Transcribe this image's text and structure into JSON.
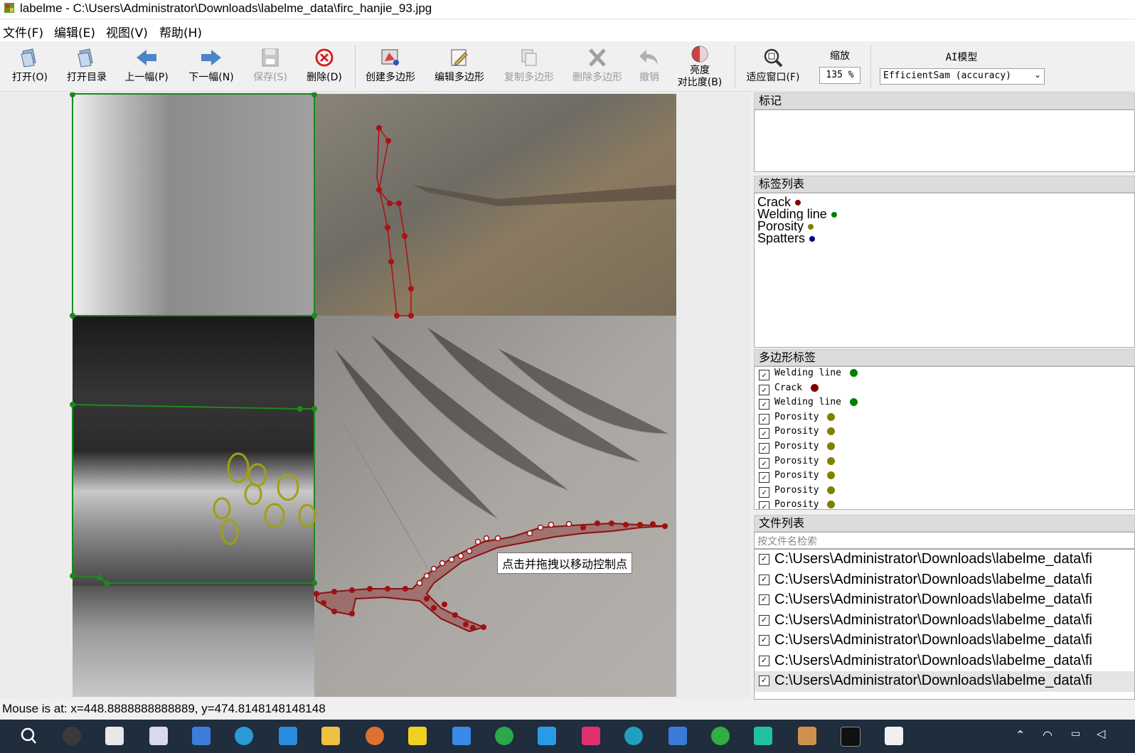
{
  "window": {
    "title": "labelme - C:\\Users\\Administrator\\Downloads\\labelme_data\\firc_hanjie_93.jpg"
  },
  "menu": [
    "文件(F)",
    "编辑(E)",
    "视图(V)",
    "帮助(H)"
  ],
  "toolbar": {
    "open": "打开(O)",
    "open_dir": "打开目录",
    "prev": "上一幅(P)",
    "next": "下一幅(N)",
    "save": "保存(S)",
    "delete": "删除(D)",
    "create_poly": "创建多边形",
    "edit_poly": "编辑多边形",
    "copy_poly": "复制多边形",
    "delete_poly": "删除多边形",
    "undo": "撤销",
    "brightness_line1": "亮度",
    "brightness_line2": "对比度(B)",
    "fit_window": "适应窗口(F)",
    "zoom_label": "缩放",
    "zoom_value": "135 %",
    "ai_label": "AI模型",
    "ai_model": "EfficientSam (accuracy)"
  },
  "canvas": {
    "tooltip": "点击并拖拽以移动控制点"
  },
  "docks": {
    "flags_title": "标记",
    "labels_title": "标签列表",
    "labels": [
      {
        "name": "Crack",
        "color": "#8b0000"
      },
      {
        "name": "Welding line",
        "color": "#008000"
      },
      {
        "name": "Porosity",
        "color": "#808000"
      },
      {
        "name": "Spatters",
        "color": "#000080"
      }
    ],
    "polygons_title": "多边形标签",
    "polygons": [
      {
        "name": "Welding line",
        "color": "#008000"
      },
      {
        "name": "Crack",
        "color": "#800000"
      },
      {
        "name": "Welding line",
        "color": "#008000"
      },
      {
        "name": "Porosity",
        "color": "#808000"
      },
      {
        "name": "Porosity",
        "color": "#808000"
      },
      {
        "name": "Porosity",
        "color": "#808000"
      },
      {
        "name": "Porosity",
        "color": "#808000"
      },
      {
        "name": "Porosity",
        "color": "#808000"
      },
      {
        "name": "Porosity",
        "color": "#808000"
      },
      {
        "name": "Porosity",
        "color": "#808000"
      }
    ],
    "files_title": "文件列表",
    "files_search_placeholder": "按文件名检索",
    "files": [
      "C:\\Users\\Administrator\\Downloads\\labelme_data\\fi",
      "C:\\Users\\Administrator\\Downloads\\labelme_data\\fi",
      "C:\\Users\\Administrator\\Downloads\\labelme_data\\fi",
      "C:\\Users\\Administrator\\Downloads\\labelme_data\\fi",
      "C:\\Users\\Administrator\\Downloads\\labelme_data\\fi",
      "C:\\Users\\Administrator\\Downloads\\labelme_data\\fi",
      "C:\\Users\\Administrator\\Downloads\\labelme_data\\fi"
    ]
  },
  "status": {
    "mouse": "Mouse is at: x=448.8888888888889, y=474.8148148148148"
  }
}
